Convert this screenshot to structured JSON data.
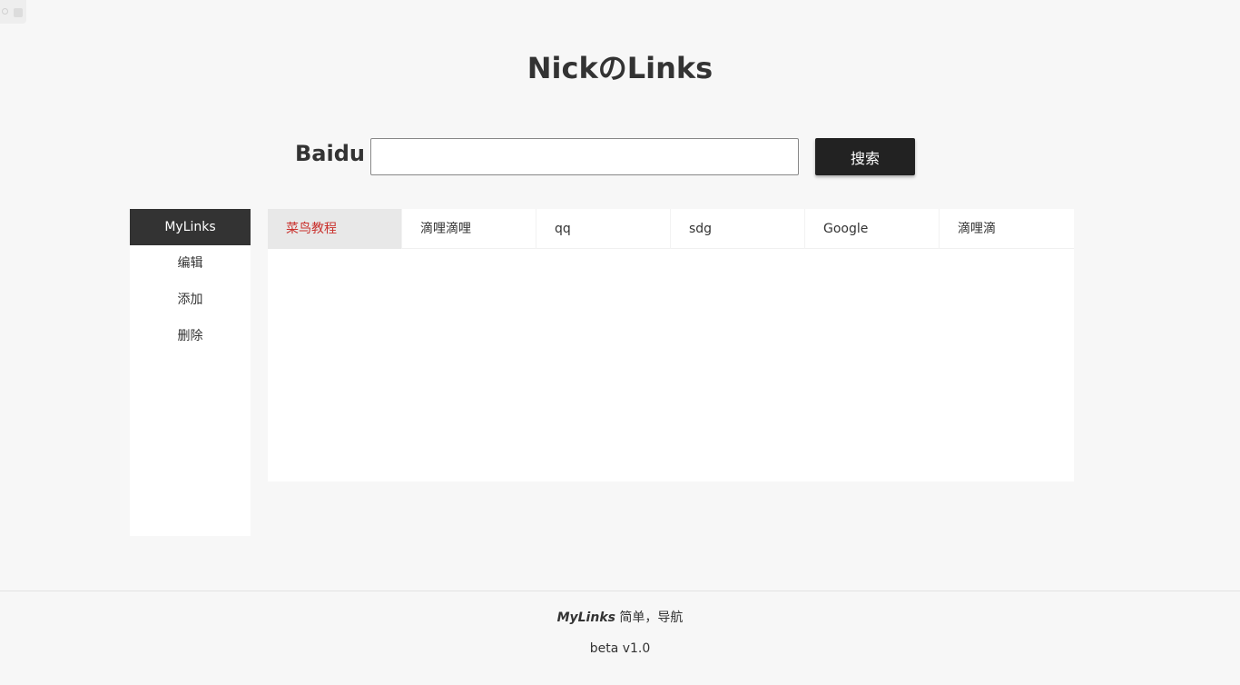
{
  "header": {
    "title": "NickのLinks"
  },
  "search": {
    "engine_label": "Baidu",
    "value": "",
    "placeholder": "",
    "button_label": "搜索"
  },
  "sidebar": {
    "items": [
      {
        "label": "MyLinks",
        "active": true
      },
      {
        "label": "编辑",
        "active": false
      },
      {
        "label": "添加",
        "active": false
      },
      {
        "label": "删除",
        "active": false
      }
    ]
  },
  "tabs": [
    {
      "label": "菜鸟教程",
      "active": true
    },
    {
      "label": "滴哩滴哩",
      "active": false
    },
    {
      "label": "qq",
      "active": false
    },
    {
      "label": "sdg",
      "active": false
    },
    {
      "label": "Google",
      "active": false
    },
    {
      "label": "滴哩滴",
      "active": false
    }
  ],
  "footer": {
    "brand": "MyLinks",
    "tagline": " 简单，导航",
    "version": "beta v1.0"
  },
  "colors": {
    "background": "#f7f7f7",
    "dark": "#333333",
    "button": "#222222",
    "active_tab_text": "#c9302c",
    "active_tab_bg": "#e8e8e8"
  }
}
